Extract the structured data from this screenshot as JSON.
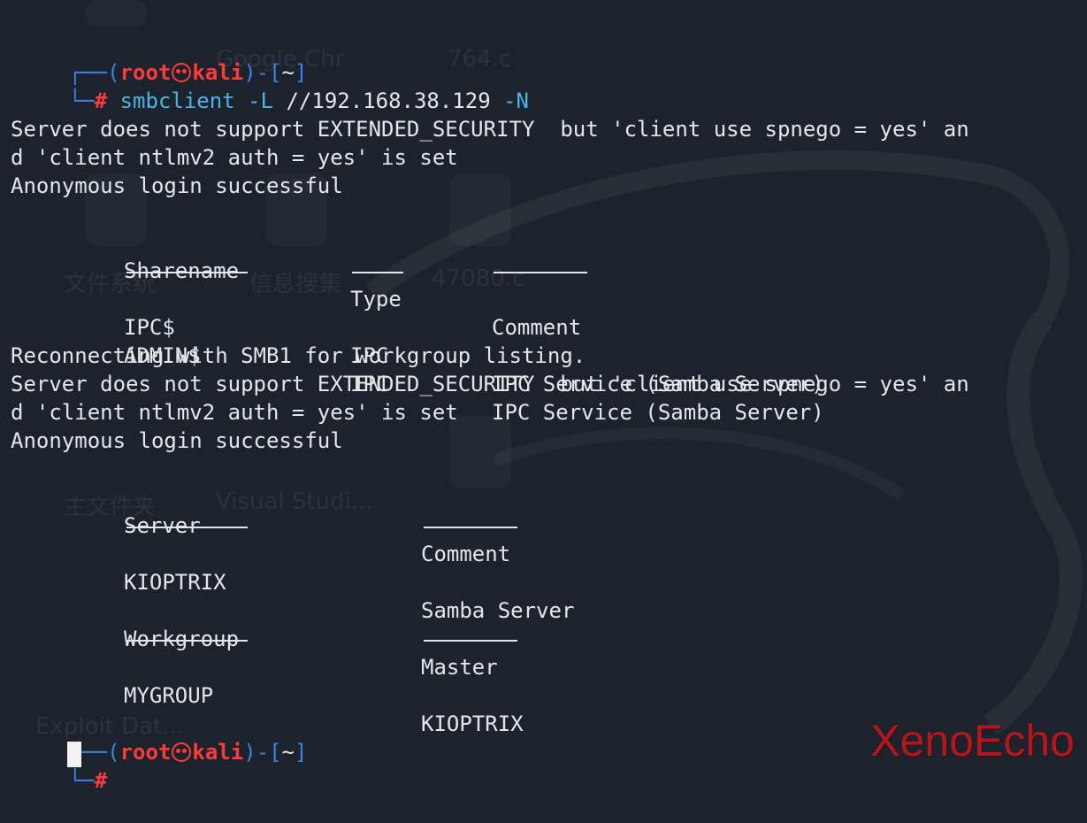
{
  "background_labels": [
    "Google Chr",
    "764.c",
    "文件系统",
    "信息搜集",
    "47080.c",
    "主文件夹",
    "Visual Studi...",
    "Exploit Dat..."
  ],
  "prompt": {
    "user": "root",
    "host": "kali",
    "dir": "~",
    "symbol": "#"
  },
  "command": {
    "program": "smbclient",
    "flag1": "-L",
    "target": "//192.168.38.129",
    "flag2": "-N"
  },
  "output": {
    "warn1_a": "Server does not support EXTENDED_SECURITY  but 'client use spnego = yes' an",
    "warn1_b": "d 'client ntlmv2 auth = yes' is set",
    "anon1": "Anonymous login successful",
    "share_headers": [
      "Sharename",
      "Type",
      "Comment"
    ],
    "shares": [
      {
        "name": "IPC$",
        "type": "IPC",
        "comment": "IPC Service (Samba Server)"
      },
      {
        "name": "ADMIN$",
        "type": "IPC",
        "comment": "IPC Service (Samba Server)"
      }
    ],
    "reconnect": "Reconnecting with SMB1 for workgroup listing.",
    "warn2_a": "Server does not support EXTENDED_SECURITY  but 'client use spnego = yes' an",
    "warn2_b": "d 'client ntlmv2 auth = yes' is set",
    "anon2": "Anonymous login successful",
    "server_headers": [
      "Server",
      "Comment"
    ],
    "servers": [
      {
        "name": "KIOPTRIX",
        "comment": "Samba Server"
      }
    ],
    "workgroup_headers": [
      "Workgroup",
      "Master"
    ],
    "workgroups": [
      {
        "name": "MYGROUP",
        "master": "KIOPTRIX"
      }
    ]
  },
  "watermark": "XenoEcho",
  "colors": {
    "background": "#1d232c",
    "prompt_frame": "#3b82e6",
    "prompt_user": "#ff3b3b",
    "command": "#4fb3e6",
    "text": "#e4e6ea"
  }
}
